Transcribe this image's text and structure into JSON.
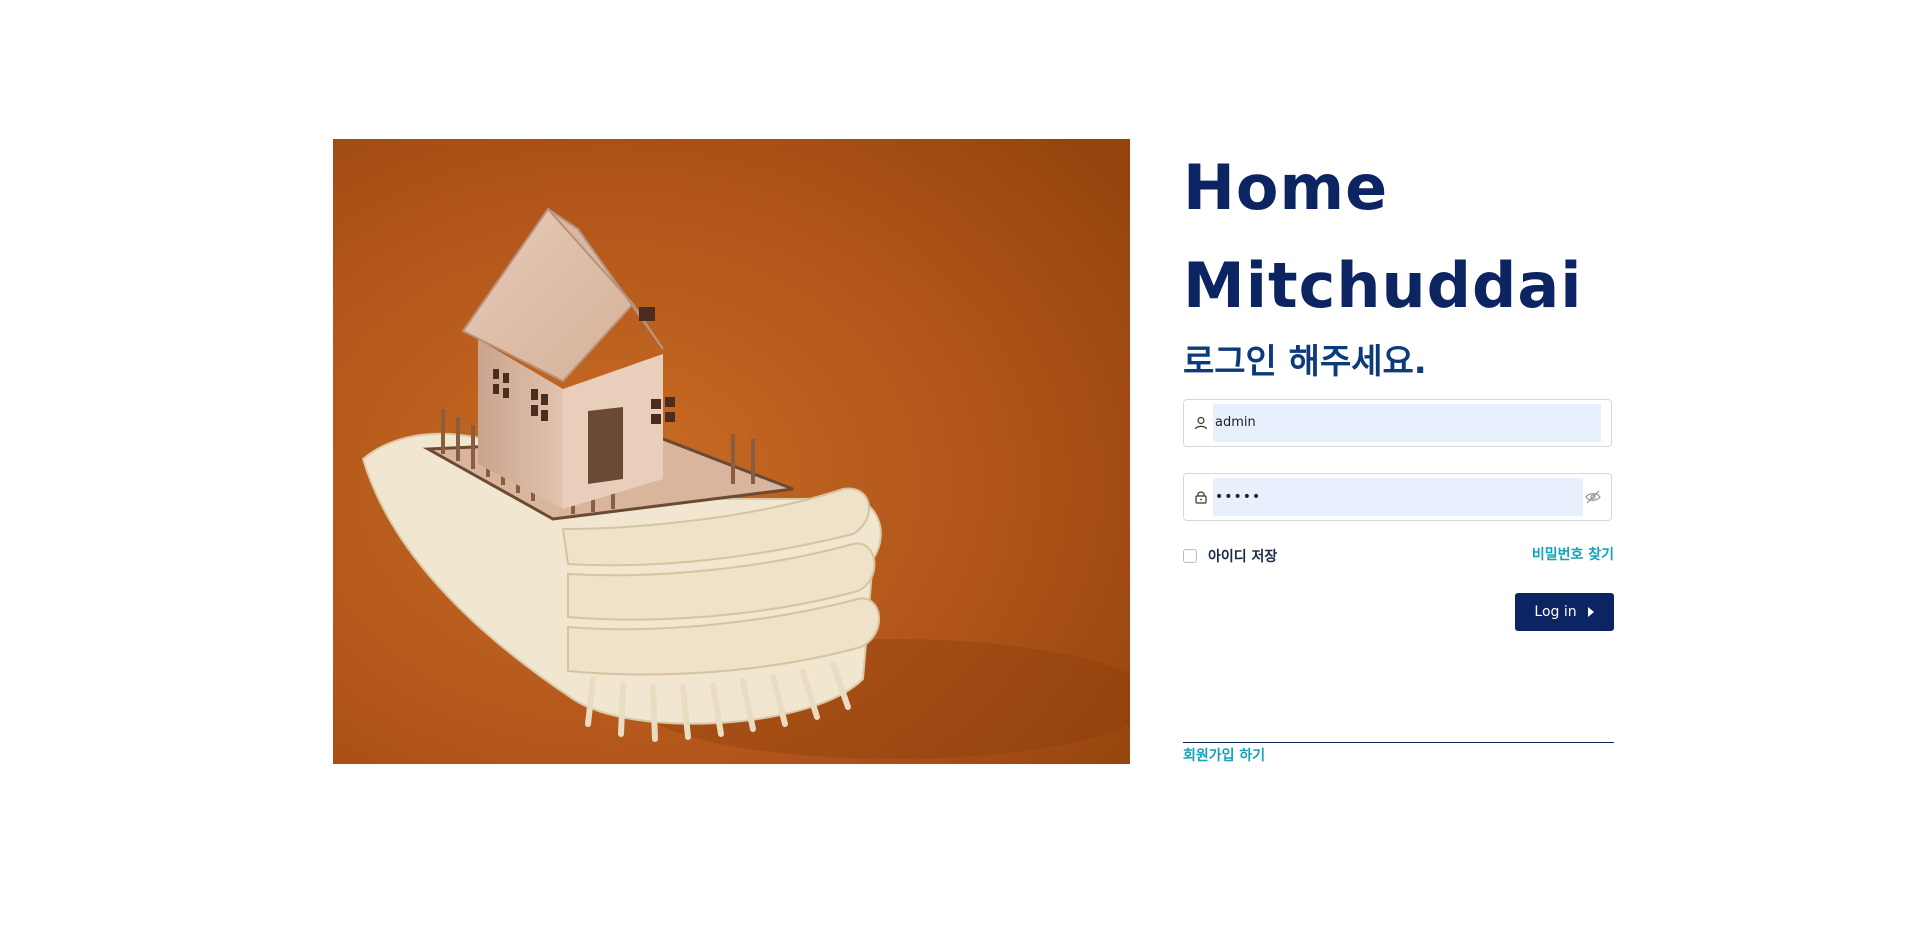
{
  "brand": {
    "line1": "Home",
    "line2": "Mitchuddai"
  },
  "login": {
    "heading": "로그인 해주세요.",
    "username_value": "admin",
    "password_value": "•••••",
    "remember_label": "아이디 저장",
    "find_password_label": "비밀번호 찾기",
    "login_button_label": "Log in",
    "signup_label": "회원가입 하기"
  },
  "colors": {
    "brand_navy": "#0c2461",
    "accent_teal": "#12a3b8",
    "input_fill": "#e8effd",
    "hero_orange": "#b4561a"
  },
  "icons": {
    "username": "user-icon",
    "password": "lock-icon",
    "toggle_password": "eye-slash-icon",
    "login_arrow": "caret-right-icon"
  }
}
